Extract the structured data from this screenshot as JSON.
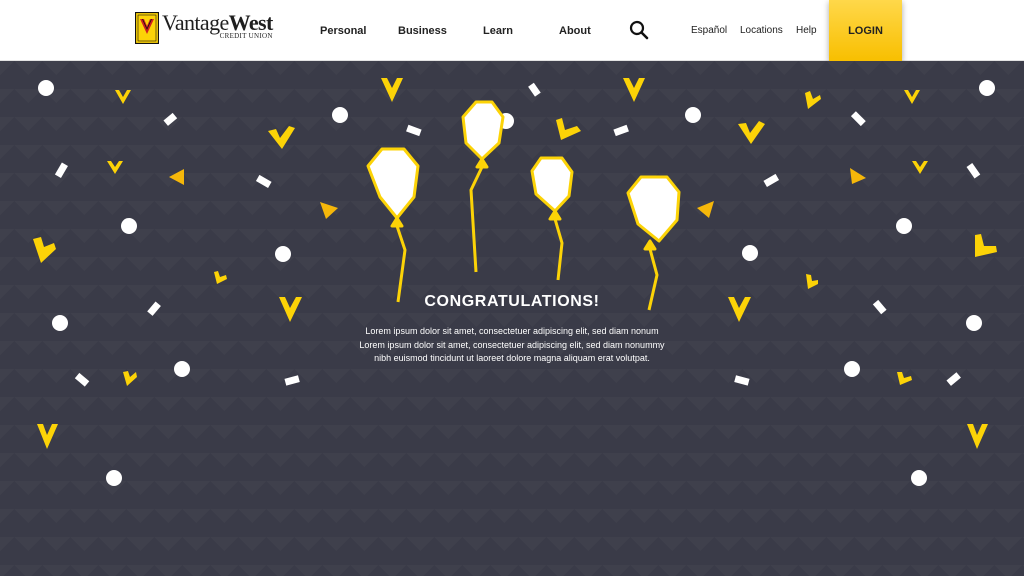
{
  "brand": {
    "name_light": "Vantage",
    "name_bold": "West",
    "subtitle": "CREDIT UNION",
    "colors": {
      "yellow": "#fcd307",
      "dark": "#3a3b48",
      "white": "#ffffff"
    }
  },
  "nav": {
    "items": [
      {
        "label": "Personal"
      },
      {
        "label": "Business"
      },
      {
        "label": "Learn"
      },
      {
        "label": "About"
      }
    ],
    "search_icon": "magnifier-icon"
  },
  "utility": {
    "items": [
      {
        "label": "Español"
      },
      {
        "label": "Locations"
      },
      {
        "label": "Help"
      }
    ]
  },
  "login": {
    "label": "LOGIN"
  },
  "hero": {
    "title": "CONGRATULATIONS!",
    "body_lines": [
      "Lorem ipsum dolor sit amet, consectetuer adipiscing elit, sed diam nonum",
      "Lorem ipsum dolor sit amet, consectetuer adipiscing elit, sed diam nonummy",
      "nibh euismod tincidunt ut laoreet dolore magna aliquam erat volutpat."
    ],
    "decorations": [
      "balloon-icon",
      "confetti-chevron",
      "confetti-dot",
      "confetti-square",
      "confetti-triangle"
    ]
  }
}
